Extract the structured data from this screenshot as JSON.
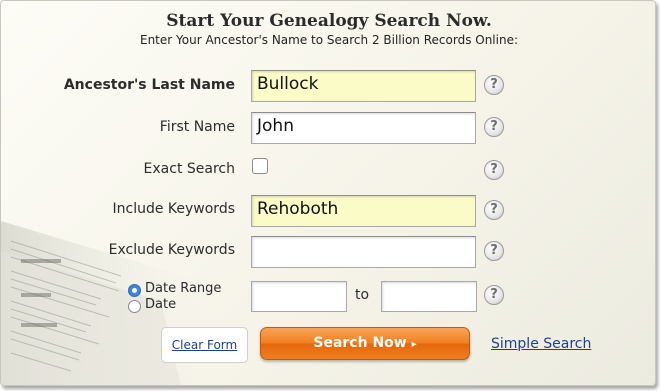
{
  "header": {
    "title": "Start Your Genealogy Search Now.",
    "subtitle": "Enter Your Ancestor's Name to Search 2 Billion Records Online:"
  },
  "form": {
    "last_name": {
      "label": "Ancestor's Last Name",
      "value": "Bullock"
    },
    "first_name": {
      "label": "First Name",
      "value": "John"
    },
    "exact_search": {
      "label": "Exact Search",
      "checked": false
    },
    "include_keywords": {
      "label": "Include Keywords",
      "value": "Rehoboth"
    },
    "exclude_keywords": {
      "label": "Exclude Keywords",
      "value": ""
    },
    "date": {
      "options": [
        "Date Range",
        "Date"
      ],
      "selected": "Date Range",
      "from_value": "",
      "to_label": "to",
      "to_value": ""
    },
    "help_glyph": "?"
  },
  "actions": {
    "clear_label": "Clear Form",
    "search_label": "Search Now",
    "search_arrow": "▸",
    "simple_search_label": "Simple Search"
  },
  "colors": {
    "highlight_field": "#fafbc6",
    "search_button": "#f1801f",
    "link": "#1f3f96"
  }
}
